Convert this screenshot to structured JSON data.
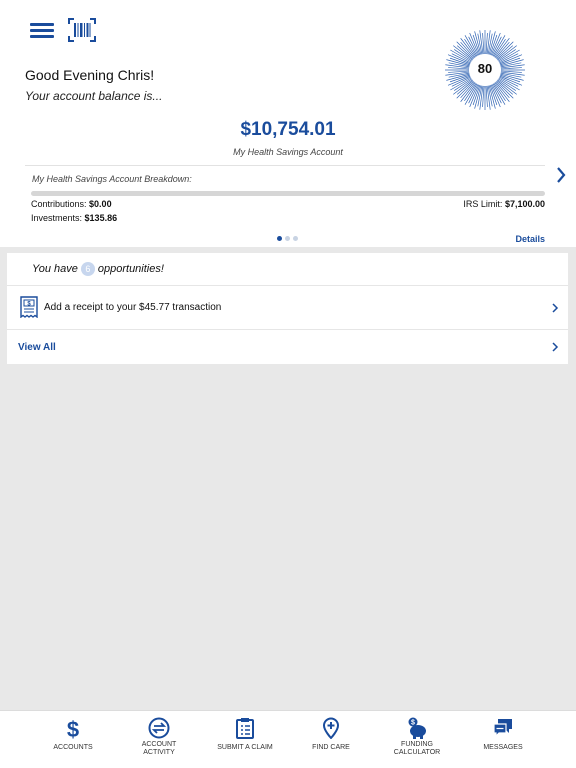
{
  "header": {
    "menu_icon": "hamburger-icon",
    "barcode_icon": "barcode-scan-icon",
    "greeting": "Good Evening Chris!",
    "subgreeting": "Your account balance is...",
    "score": "80"
  },
  "account": {
    "balance": "$10,754.01",
    "name": "My Health Savings Account",
    "breakdown_title": "My Health Savings Account Breakdown:",
    "contributions_label": "Contributions:",
    "contributions_value": "$0.00",
    "investments_label": "Investments:",
    "investments_value": "$135.86",
    "irs_label": "IRS Limit:",
    "irs_value": "$7,100.00",
    "contribution_progress": 0,
    "details_label": "Details",
    "page_count": 3,
    "page_index": 0
  },
  "opportunities": {
    "prefix": "You have",
    "count": "6",
    "suffix": "opportunities!",
    "receipt_text": "Add a receipt to your $45.77 transaction",
    "view_all": "View All"
  },
  "tabs": [
    {
      "line1": "Accounts",
      "line2": "",
      "icon": "dollar-icon"
    },
    {
      "line1": "Account",
      "line2": "Activity",
      "icon": "transfer-arrows-icon"
    },
    {
      "line1": "Submit a Claim",
      "line2": "",
      "icon": "clipboard-icon"
    },
    {
      "line1": "Find Care",
      "line2": "",
      "icon": "location-plus-icon"
    },
    {
      "line1": "Funding",
      "line2": "Calculator",
      "icon": "piggy-bank-icon"
    },
    {
      "line1": "Messages",
      "line2": "",
      "icon": "chat-bubbles-icon"
    }
  ],
  "colors": {
    "accent": "#1a4c9c",
    "background": "#e8e8e8",
    "card": "#ffffff"
  }
}
